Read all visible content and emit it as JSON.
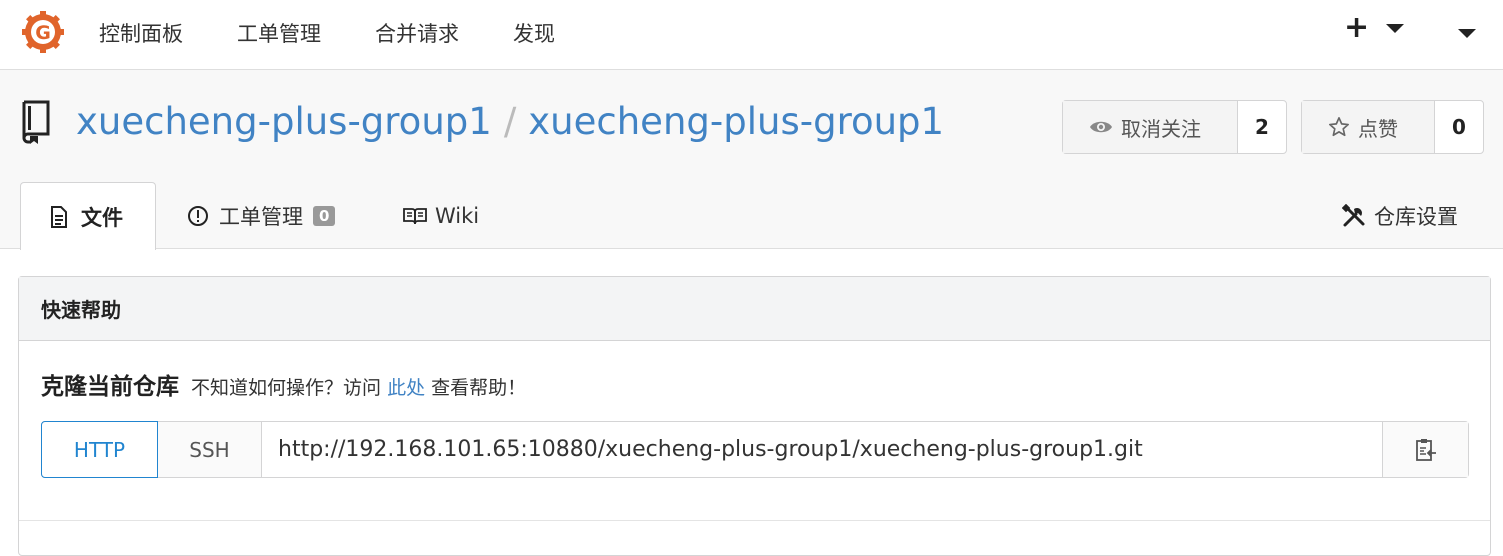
{
  "nav": {
    "items": [
      "控制面板",
      "工单管理",
      "合并请求",
      "发现"
    ],
    "plus": "+"
  },
  "repo": {
    "owner": "xuecheng-plus-group1",
    "separator": "/",
    "name": "xuecheng-plus-group1",
    "watch_label": "取消关注",
    "watch_count": "2",
    "star_label": "点赞",
    "star_count": "0"
  },
  "tabs": {
    "files": "文件",
    "issues": "工单管理",
    "issues_count": "0",
    "wiki": "Wiki",
    "settings": "仓库设置"
  },
  "help": {
    "title": "快速帮助",
    "clone_title": "克隆当前仓库",
    "clone_hint_pre": "不知道如何操作？访问",
    "clone_hint_link": "此处",
    "clone_hint_post": "查看帮助！",
    "http": "HTTP",
    "ssh": "SSH",
    "url": "http://192.168.101.65:10880/xuecheng-plus-group1/xuecheng-plus-group1.git"
  },
  "colors": {
    "link": "#4183c4",
    "accent": "#2185d0",
    "logo": "#e0642b"
  },
  "icons": [
    "gitea-logo",
    "repo-book-icon",
    "eye-icon",
    "star-icon",
    "file-text-icon",
    "alert-circle-icon",
    "book-open-icon",
    "tools-icon",
    "clipboard-icon"
  ]
}
